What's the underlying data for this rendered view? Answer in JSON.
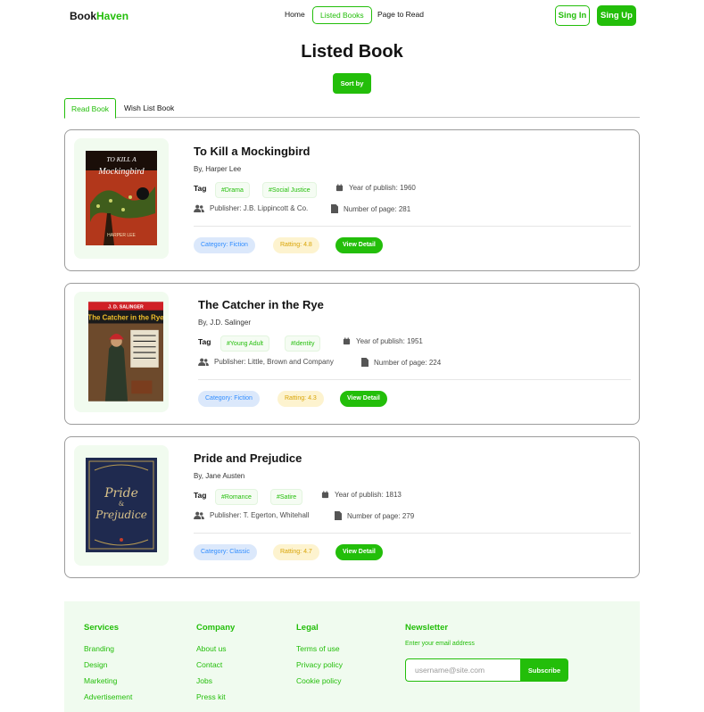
{
  "brand": {
    "name_part1": "Book",
    "name_part2": "Haven",
    "accent": "#23BE0A"
  },
  "nav": {
    "home": "Home",
    "listed": "Listed Books",
    "to_read": "Page to Read",
    "sign_in": "Sing In",
    "sign_up": "Sing Up"
  },
  "page": {
    "title": "Listed Book",
    "sort_label": "Sort by"
  },
  "tabs": {
    "read": "Read Book",
    "wish": "Wish List Book"
  },
  "labels": {
    "tag": "Tag",
    "view_detail": "View Detail"
  },
  "books": [
    {
      "title": "To Kill a Mockingbird",
      "author": "By, Harper Lee",
      "tags": [
        "#Drama",
        "#Social Justice"
      ],
      "year": "Year of publish: 1960",
      "publisher": "Publisher: J.B. Lippincott & Co.",
      "pages": "Number of page: 281",
      "category": "Category: Fiction",
      "rating": "Ratting: 4.8",
      "cover": {
        "line1": "TO KILL A",
        "line2": "Mockingbird",
        "line3": "HARPER LEE"
      }
    },
    {
      "title": "The Catcher in the Rye",
      "author": "By, J.D. Salinger",
      "tags": [
        "#Young Adult",
        "#Identity"
      ],
      "year": "Year of publish: 1951",
      "publisher": "Publisher: Little, Brown and Company",
      "pages": "Number of page: 224",
      "category": "Category: Fiction",
      "rating": "Ratting: 4.3",
      "cover": {
        "line1": "J. D. SALINGER",
        "line2": "The Catcher in the Rye"
      }
    },
    {
      "title": "Pride and Prejudice",
      "author": "By, Jane Austen",
      "tags": [
        "#Romance",
        "#Satire"
      ],
      "year": "Year of publish: 1813",
      "publisher": "Publisher: T. Egerton, Whitehall",
      "pages": "Number of page: 279",
      "category": "Category: Classic",
      "rating": "Ratting: 4.7",
      "cover": {
        "line1": "Pride",
        "line2": "&",
        "line3": "Prejudice"
      }
    }
  ],
  "footer": {
    "services": {
      "title": "Services",
      "links": [
        "Branding",
        "Design",
        "Marketing",
        "Advertisement"
      ]
    },
    "company": {
      "title": "Company",
      "links": [
        "About us",
        "Contact",
        "Jobs",
        "Press kit"
      ]
    },
    "legal": {
      "title": "Legal",
      "links": [
        "Terms of use",
        "Privacy policy",
        "Cookie policy"
      ]
    },
    "newsletter": {
      "title": "Newsletter",
      "label": "Enter your email address",
      "placeholder": "username@site.com",
      "button": "Subscribe"
    }
  }
}
